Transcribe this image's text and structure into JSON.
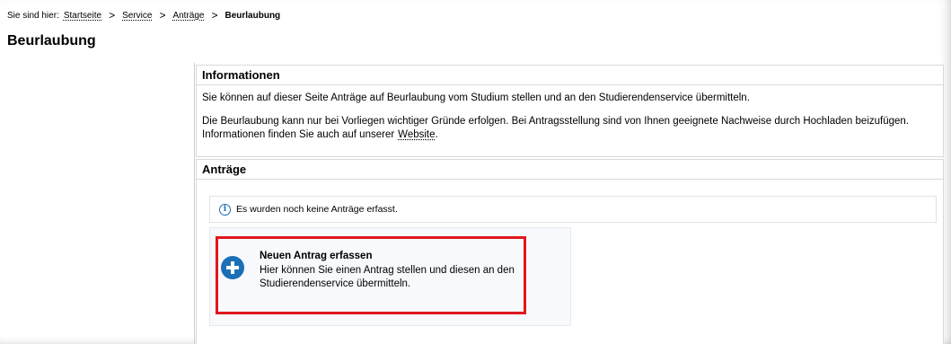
{
  "breadcrumb": {
    "prefix": "Sie sind hier:",
    "items": [
      "Startseite",
      "Service",
      "Anträge"
    ],
    "current": "Beurlaubung"
  },
  "page": {
    "title": "Beurlaubung"
  },
  "info_section": {
    "heading": "Informationen",
    "paragraph1": "Sie können auf dieser Seite Anträge auf Beurlaubung vom Studium stellen und an den Studierendenservice übermitteln.",
    "paragraph2_line1": "Die Beurlaubung kann nur bei Vorliegen wichtiger Gründe erfolgen. Bei Antragsstellung sind von Ihnen geeignete Nachweise durch Hochladen beizufügen.",
    "paragraph2_line2": "Informationen finden Sie auch auf unserer",
    "link_label": "Website",
    "link_suffix": "."
  },
  "antraege_section": {
    "heading": "Anträge",
    "notice": "Es wurden noch keine Anträge erfasst.",
    "new_request": {
      "title": "Neuen Antrag erfassen",
      "description": "Hier können Sie einen Antrag stellen und diesen an den Studierendenservice übermitteln.",
      "icon": "plus-circle-icon"
    }
  },
  "colors": {
    "accent": "#1a6fb5",
    "highlight": "#e0181e"
  }
}
